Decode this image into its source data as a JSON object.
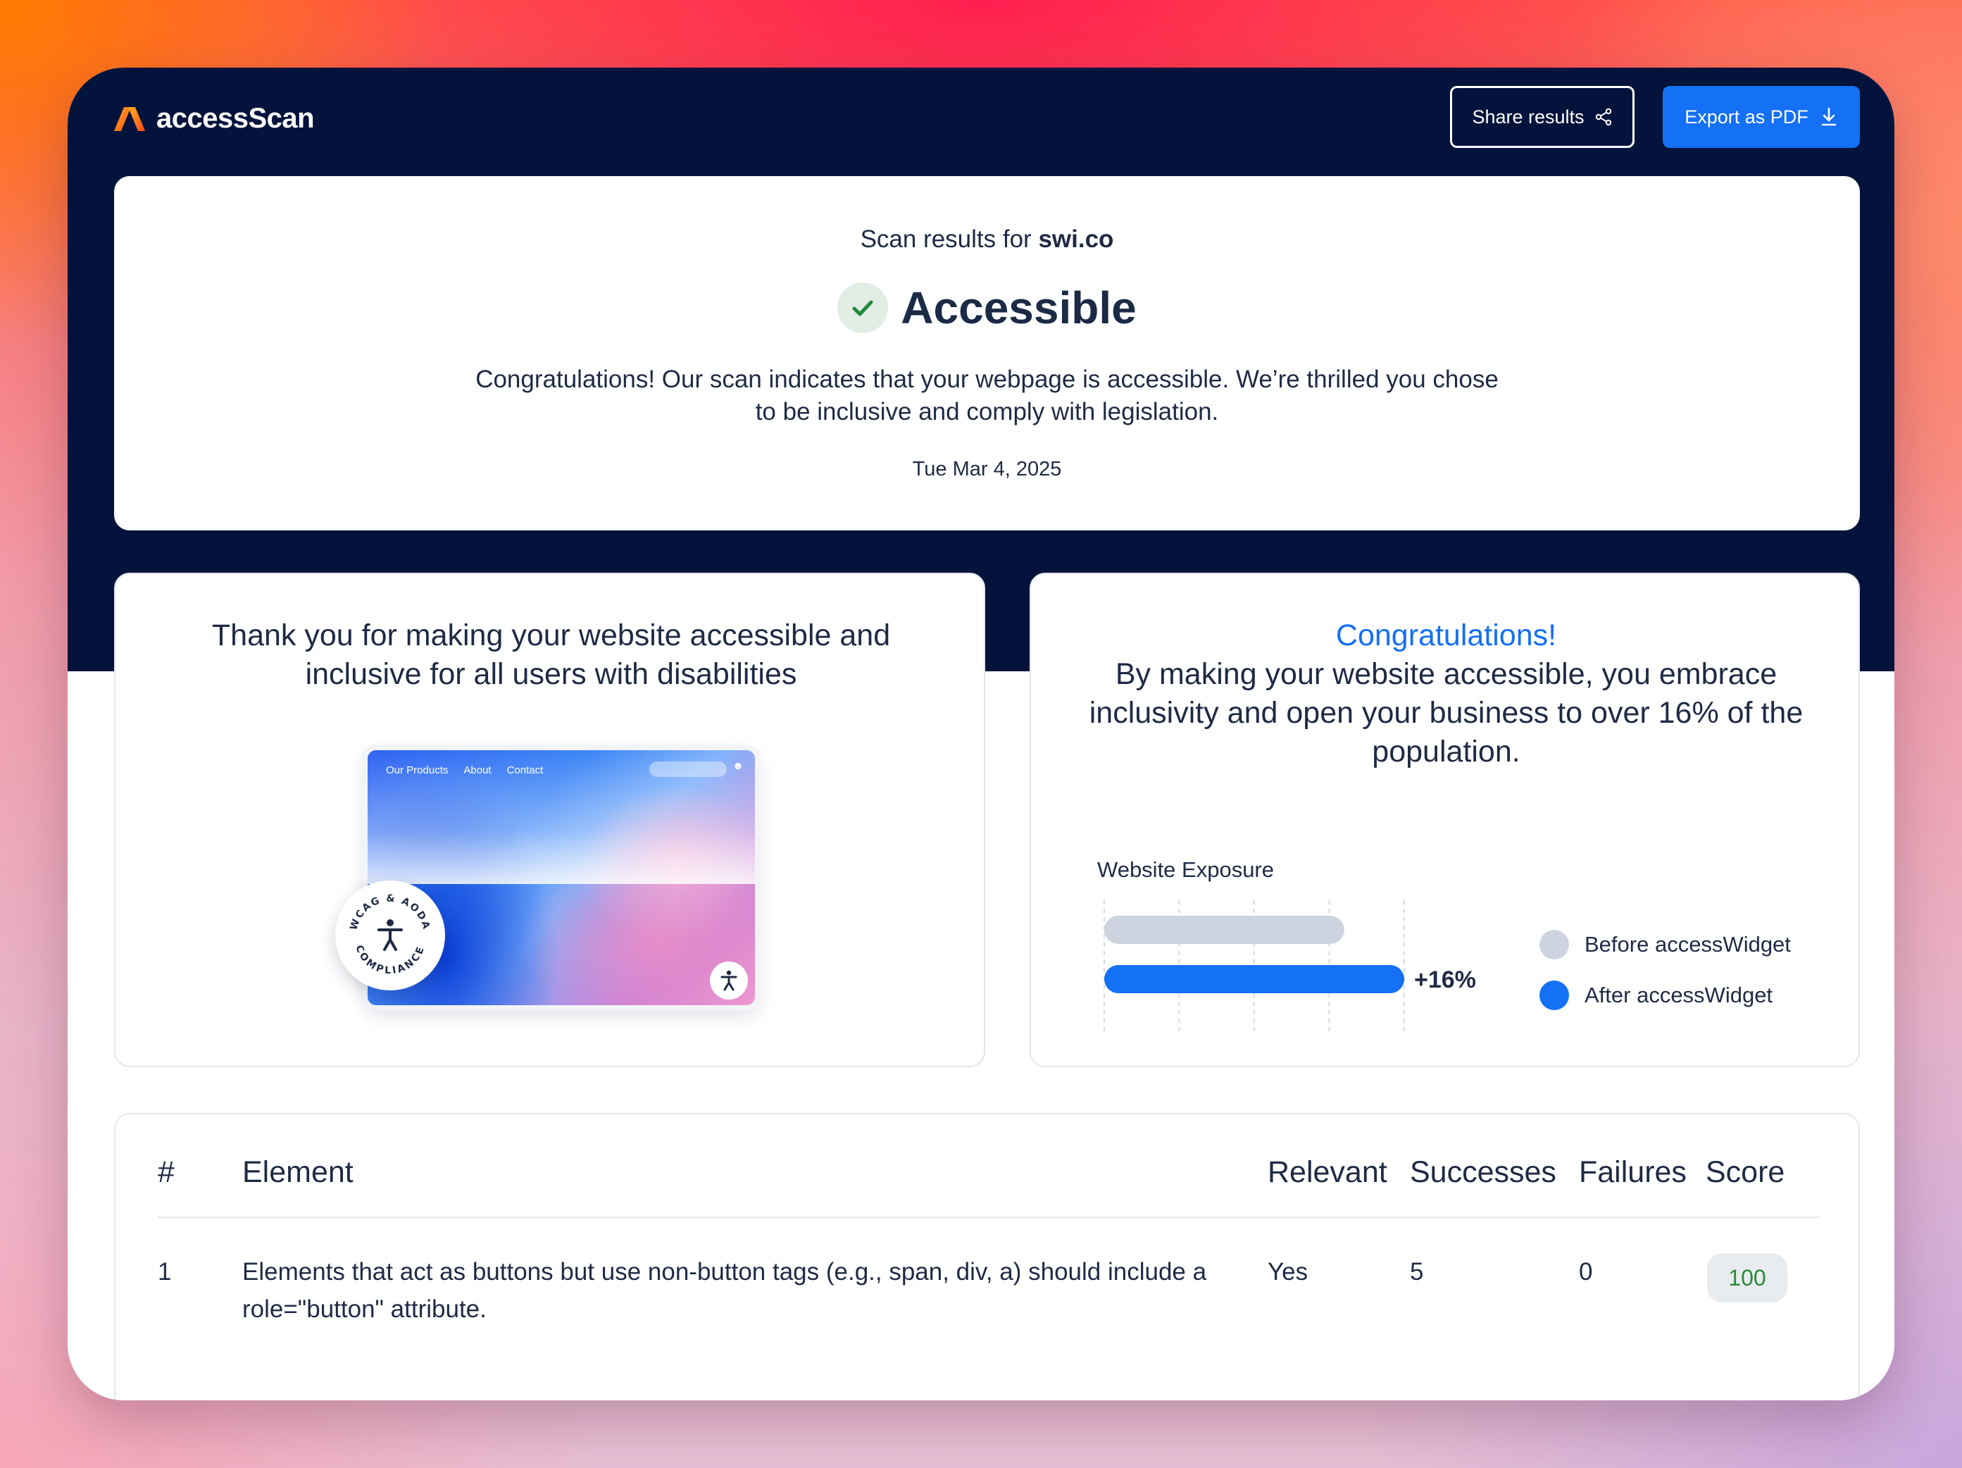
{
  "header": {
    "brand": "accessScan",
    "share_label": "Share results",
    "export_label": "Export as PDF"
  },
  "result": {
    "scan_prefix": "Scan results for",
    "domain": "swi.co",
    "status": "Accessible",
    "message": "Congratulations! Our scan indicates that your webpage is accessible. We’re thrilled you chose to be inclusive and comply with legislation.",
    "date": "Tue Mar 4, 2025"
  },
  "thanks": {
    "title": "Thank you for making your website accessible and inclusive for all users with disabilities",
    "mock_nav": [
      "Our Products",
      "About",
      "Contact"
    ],
    "badge_top": "WCAG & AODA",
    "badge_bottom": "COMPLIANCE"
  },
  "congrats": {
    "heading": "Congratulations!",
    "body": "By making your website accessible, you embrace inclusivity and open your business to over 16% of the population."
  },
  "chart_data": {
    "type": "bar",
    "title": "Website Exposure",
    "categories": [
      "Before accessWidget",
      "After accessWidget"
    ],
    "values": [
      80,
      100
    ],
    "annotation": "+16%",
    "colors": [
      "#cdd4e0",
      "#1470f5"
    ],
    "legend": [
      "Before accessWidget",
      "After accessWidget"
    ],
    "legend_placement": "right",
    "grid": true
  },
  "table": {
    "headers": [
      "#",
      "Element",
      "Relevant",
      "Successes",
      "Failures",
      "Score"
    ],
    "rows": [
      {
        "num": "1",
        "element": "Elements that act as buttons but use non-button tags (e.g., span, div, a) should include a role=\"button\" attribute.",
        "relevant": "Yes",
        "successes": "5",
        "failures": "0",
        "score": "100"
      }
    ]
  },
  "colors": {
    "navy": "#03133b",
    "accent": "#1470f5",
    "success": "#2b8a3a",
    "brand_orange": "#ff6a1a"
  },
  "icons": [
    "logo-mark-icon",
    "share-icon",
    "download-icon",
    "check-icon",
    "accessibility-icon"
  ]
}
